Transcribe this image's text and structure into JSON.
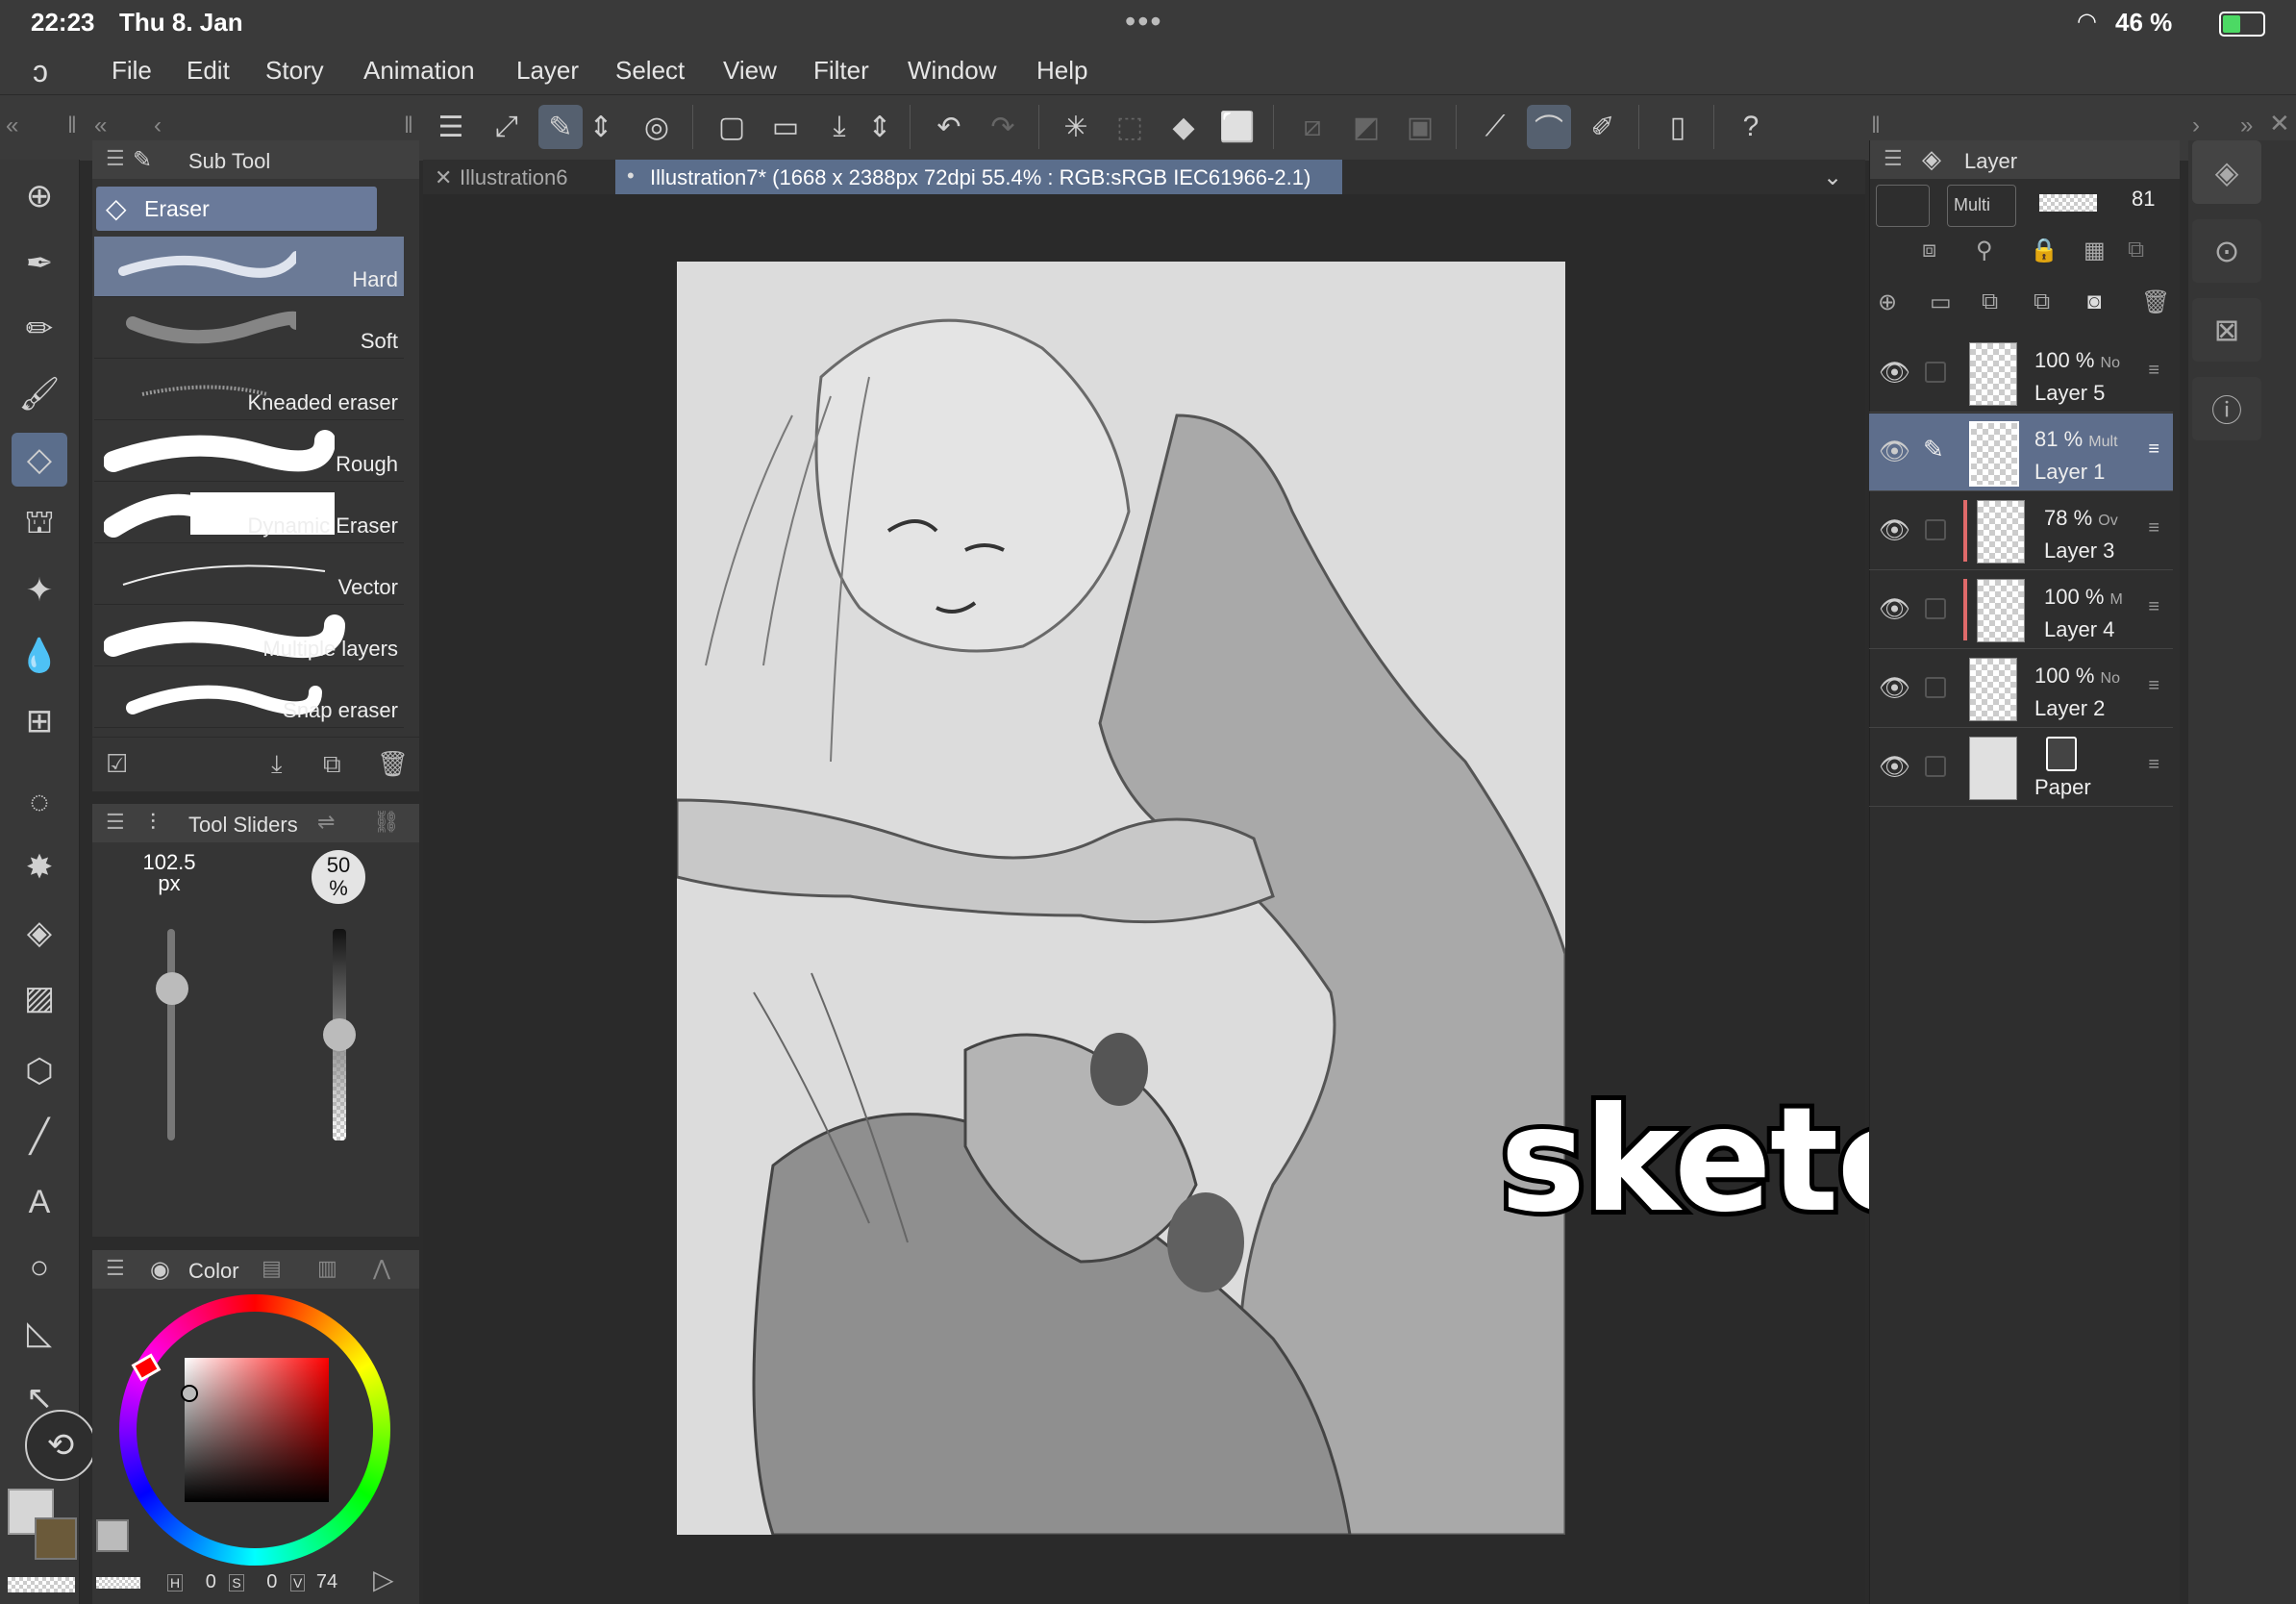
{
  "status_bar": {
    "time": "22:23",
    "date": "Thu 8. Jan",
    "battery": "46 %"
  },
  "menu": [
    "File",
    "Edit",
    "Story",
    "Animation",
    "Layer",
    "Select",
    "View",
    "Filter",
    "Window",
    "Help"
  ],
  "sub_tool": {
    "title": "Sub Tool",
    "group": "Eraser",
    "brushes": [
      "Hard",
      "Soft",
      "Kneaded eraser",
      "Rough",
      "Dynamic Eraser",
      "Vector",
      "Multiple layers",
      "Snap eraser"
    ],
    "selected": "Hard"
  },
  "tool_sliders": {
    "title": "Tool Sliders",
    "size_value": "102.5",
    "size_unit": "px",
    "opacity_value": "50",
    "opacity_unit": "%",
    "size_level": 0.72,
    "opacity_level": 0.5
  },
  "color": {
    "title": "Color",
    "h_label": "H",
    "h_value": "0",
    "s_label": "S",
    "s_value": "0",
    "v_label": "V",
    "v_value": "74"
  },
  "tabs": {
    "inactive": "Illustration6",
    "active": "Illustration7* (1668 x 2388px 72dpi 55.4% : RGB:sRGB IEC61966-2.1)"
  },
  "overlay_text": "sketch",
  "layer_panel": {
    "title": "Layer",
    "blend_mode": "Multi",
    "opacity": "81",
    "layers": [
      {
        "pct": "100 %",
        "mode": "No",
        "name": "Layer 5"
      },
      {
        "pct": "81 %",
        "mode": "Mult",
        "name": "Layer 1"
      },
      {
        "pct": "78 %",
        "mode": "Ov",
        "name": "Layer 3"
      },
      {
        "pct": "100 %",
        "mode": "M",
        "name": "Layer 4"
      },
      {
        "pct": "100 %",
        "mode": "No",
        "name": "Layer 2"
      },
      {
        "pct": "",
        "mode": "",
        "name": "Paper"
      }
    ]
  },
  "colors": {
    "accent": "#5b6e8c",
    "clip_marker": "#e06a6a",
    "paper": "#d9d9d9"
  }
}
